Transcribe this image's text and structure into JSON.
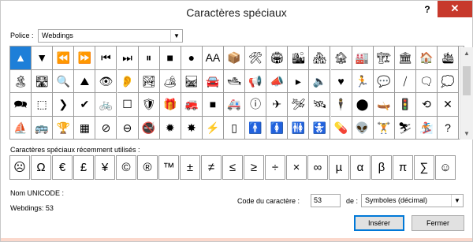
{
  "window": {
    "title": "Caractères spéciaux",
    "help": "?",
    "close": "✕"
  },
  "font_label": "Police :",
  "font_select": {
    "value": "Webdings"
  },
  "grid_rows": [
    [
      {
        "icon": "triangle-up-icon",
        "glyph": "▲"
      },
      {
        "icon": "triangle-down-icon",
        "glyph": "▼"
      },
      {
        "icon": "rewind-icon",
        "glyph": "⏪"
      },
      {
        "icon": "fast-forward-icon",
        "glyph": "⏩"
      },
      {
        "icon": "skip-back-icon",
        "glyph": "⏮"
      },
      {
        "icon": "skip-forward-icon",
        "glyph": "⏭"
      },
      {
        "icon": "pause-icon",
        "glyph": "⏸"
      },
      {
        "icon": "stop-icon",
        "glyph": "■"
      },
      {
        "icon": "record-icon",
        "glyph": "●"
      },
      {
        "icon": "font-size-icon",
        "glyph": "AA"
      },
      {
        "icon": "package-icon",
        "glyph": "📦"
      },
      {
        "icon": "tools-icon",
        "glyph": "🛠"
      },
      {
        "icon": "stadium-icon",
        "glyph": "🏟"
      },
      {
        "icon": "city-icon",
        "glyph": "🏙"
      },
      {
        "icon": "houses-icon",
        "glyph": "🏘"
      },
      {
        "icon": "building-icon",
        "glyph": "🏚"
      },
      {
        "icon": "factory-icon",
        "glyph": "🏭"
      },
      {
        "icon": "industry-icon",
        "glyph": "🏗"
      },
      {
        "icon": "museum-icon",
        "glyph": "🏛"
      },
      {
        "icon": "house-icon",
        "glyph": "🏠"
      },
      {
        "icon": "ship-icon",
        "glyph": "🛳"
      }
    ],
    [
      {
        "icon": "island-icon",
        "glyph": "🏝"
      },
      {
        "icon": "road-icon",
        "glyph": "🛣"
      },
      {
        "icon": "magnifier-icon",
        "glyph": "🔍"
      },
      {
        "icon": "mountain-icon",
        "glyph": "⛰"
      },
      {
        "icon": "eye-icon",
        "glyph": "👁"
      },
      {
        "icon": "ear-icon",
        "glyph": "👂"
      },
      {
        "icon": "landscape-icon",
        "glyph": "🏞"
      },
      {
        "icon": "camping-icon",
        "glyph": "🏕"
      },
      {
        "icon": "railway-icon",
        "glyph": "🛤"
      },
      {
        "icon": "car-icon",
        "glyph": "🚘"
      },
      {
        "icon": "cruise-icon",
        "glyph": "🛥"
      },
      {
        "icon": "megaphone-icon",
        "glyph": "📢"
      },
      {
        "icon": "speaker-icon",
        "glyph": "📣"
      },
      {
        "icon": "flag-icon",
        "glyph": "▸"
      },
      {
        "icon": "volume-icon",
        "glyph": "🔈"
      },
      {
        "icon": "heart-icon",
        "glyph": "♥"
      },
      {
        "icon": "runner-icon",
        "glyph": "🏃"
      },
      {
        "icon": "speech-bubble-icon",
        "glyph": "💬"
      },
      {
        "icon": "slash-icon",
        "glyph": "⧸"
      },
      {
        "icon": "chat-icon",
        "glyph": "🗨"
      },
      {
        "icon": "comment-icon",
        "glyph": "💭"
      }
    ],
    [
      {
        "icon": "discussion-icon",
        "glyph": "🗪"
      },
      {
        "icon": "dashed-box-icon",
        "glyph": "⬚"
      },
      {
        "icon": "chevron-icon",
        "glyph": "❯"
      },
      {
        "icon": "check-icon",
        "glyph": "✔"
      },
      {
        "icon": "bicycle-icon",
        "glyph": "🚲"
      },
      {
        "icon": "empty-square-icon",
        "glyph": "☐"
      },
      {
        "icon": "shield-icon",
        "glyph": "🛡"
      },
      {
        "icon": "gift-icon",
        "glyph": "🎁"
      },
      {
        "icon": "fire-truck-icon",
        "glyph": "🚒"
      },
      {
        "icon": "black-square-icon",
        "glyph": "■"
      },
      {
        "icon": "ambulance-icon",
        "glyph": "🚑"
      },
      {
        "icon": "info-icon",
        "glyph": "ⓘ"
      },
      {
        "icon": "airplane-icon",
        "glyph": "✈"
      },
      {
        "icon": "jet-icon",
        "glyph": "🛩"
      },
      {
        "icon": "satellite-icon",
        "glyph": "🛰"
      },
      {
        "icon": "person-icon",
        "glyph": "🕴"
      },
      {
        "icon": "circle-icon",
        "glyph": "⬤"
      },
      {
        "icon": "boat-icon",
        "glyph": "🛶"
      },
      {
        "icon": "traffic-icon",
        "glyph": "🚦"
      },
      {
        "icon": "refresh-icon",
        "glyph": "⟲"
      },
      {
        "icon": "x-icon",
        "glyph": "✕"
      }
    ],
    [
      {
        "icon": "sailing-icon",
        "glyph": "⛵"
      },
      {
        "icon": "bus-icon",
        "glyph": "🚌"
      },
      {
        "icon": "trophy-icon",
        "glyph": "🏆"
      },
      {
        "icon": "tiles-icon",
        "glyph": "▦"
      },
      {
        "icon": "no-entry-icon",
        "glyph": "⊘"
      },
      {
        "icon": "prohibited-icon",
        "glyph": "⊖"
      },
      {
        "icon": "no-smoking-icon",
        "glyph": "🚭"
      },
      {
        "icon": "explosion-icon",
        "glyph": "✹"
      },
      {
        "icon": "burst-icon",
        "glyph": "✸"
      },
      {
        "icon": "lightning-icon",
        "glyph": "⚡"
      },
      {
        "icon": "phone-icon",
        "glyph": "▯"
      },
      {
        "icon": "man-icon",
        "glyph": "🚹"
      },
      {
        "icon": "woman-icon",
        "glyph": "🚺"
      },
      {
        "icon": "couple-icon",
        "glyph": "🚻"
      },
      {
        "icon": "baby-icon",
        "glyph": "🚼"
      },
      {
        "icon": "pill-icon",
        "glyph": "💊"
      },
      {
        "icon": "alien-icon",
        "glyph": "👽"
      },
      {
        "icon": "weightlifter-icon",
        "glyph": "🏋"
      },
      {
        "icon": "skier-icon",
        "glyph": "⛷"
      },
      {
        "icon": "snowboarder-icon",
        "glyph": "🏂"
      },
      {
        "icon": "question-icon",
        "glyph": "?"
      }
    ]
  ],
  "recent_label": "Caractères spéciaux récemment utilisés :",
  "recent_chars": [
    "☹",
    "Ω",
    "€",
    "£",
    "¥",
    "©",
    "®",
    "™",
    "±",
    "≠",
    "≤",
    "≥",
    "÷",
    "×",
    "∞",
    "µ",
    "α",
    "β",
    "π",
    "∑",
    "☺"
  ],
  "unicode_name_label": "Nom UNICODE :",
  "unicode_name_value": "Webdings: 53",
  "code_label": "Code du caractère :",
  "code_value": "53",
  "de_label": "de :",
  "de_select": {
    "value": "Symboles (décimal)"
  },
  "buttons": {
    "insert": "Insérer",
    "close": "Fermer"
  },
  "colors": {
    "selection": "#1e7fd8",
    "close_button": "#c7392c",
    "default_button_border": "#0078d7"
  }
}
